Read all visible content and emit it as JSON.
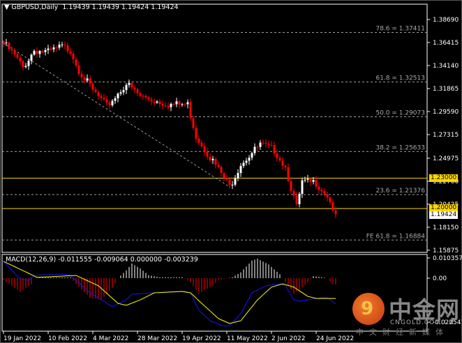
{
  "header": {
    "arrow": "▼",
    "symbol": "GBPUSD,Daily",
    "ohlc": "1.19439 1.19439 1.19424 1.19424"
  },
  "macd_header": "MACD(12,26,9) -0.011555 -0.009064 0.000000 -0.003239",
  "price_labels": {
    "line1": "1.23000",
    "line2": "1.20000",
    "current": "1.19424"
  },
  "colors": {
    "bull": "#ffffff",
    "bear": "#ff0000",
    "level": "#ffd700",
    "macd": "#1414ff",
    "signal": "#ffff00",
    "fib": "#a0a0a0"
  },
  "watermark": {
    "logo_char": "9",
    "name": "中金网",
    "url": "CNGOLD.COM.CN",
    "slogan": "中文财经新媒体"
  },
  "chart_data": {
    "type": "candlestick",
    "symbol": "GBPUSD",
    "timeframe": "Daily",
    "y_ticks": [
      "1.38690",
      "1.36415",
      "1.34140",
      "1.31865",
      "1.29590",
      "1.27315",
      "1.24975",
      "1.22700",
      "1.20425",
      "1.18150",
      "1.15875"
    ],
    "y_tick_values": [
      1.3869,
      1.36415,
      1.3414,
      1.31865,
      1.2959,
      1.27315,
      1.24975,
      1.227,
      1.20425,
      1.1815,
      1.15875
    ],
    "ylim": [
      1.155,
      1.392
    ],
    "x_ticks": [
      {
        "bar": 0,
        "label": "19 Jan 2022"
      },
      {
        "bar": 16,
        "label": "10 Feb 2022"
      },
      {
        "bar": 32,
        "label": "4 Mar 2022"
      },
      {
        "bar": 48,
        "label": "28 Mar 2022"
      },
      {
        "bar": 64,
        "label": "19 Apr 2022"
      },
      {
        "bar": 80,
        "label": "11 May 2022"
      },
      {
        "bar": 96,
        "label": "2 Jun 2022"
      },
      {
        "bar": 112,
        "label": "24 Jun 2022"
      }
    ],
    "bars": 120,
    "close_keypoints": [
      [
        0,
        1.3635
      ],
      [
        4,
        1.3511
      ],
      [
        7,
        1.3393
      ],
      [
        11,
        1.3566
      ],
      [
        16,
        1.3545
      ],
      [
        21,
        1.36
      ],
      [
        24,
        1.3566
      ],
      [
        27,
        1.337
      ],
      [
        32,
        1.3166
      ],
      [
        37,
        1.301
      ],
      [
        44,
        1.3235
      ],
      [
        49,
        1.311
      ],
      [
        54,
        1.307
      ],
      [
        60,
        1.3028
      ],
      [
        66,
        1.3028
      ],
      [
        69,
        1.2718
      ],
      [
        74,
        1.251
      ],
      [
        79,
        1.23
      ],
      [
        81,
        1.2214
      ],
      [
        85,
        1.2446
      ],
      [
        92,
        1.263
      ],
      [
        97,
        1.258
      ],
      [
        101,
        1.241
      ],
      [
        105,
        1.2007
      ],
      [
        107,
        1.2256
      ],
      [
        112,
        1.2256
      ],
      [
        116,
        1.213
      ],
      [
        119,
        1.19424
      ]
    ],
    "fib_levels": [
      {
        "label": "78.6 = 1.37411",
        "value": 1.37411
      },
      {
        "label": "61.8 = 1.32513",
        "value": 1.32513
      },
      {
        "label": "50.0 = 1.29073",
        "value": 1.29073
      },
      {
        "label": "38.2 = 1.25633",
        "value": 1.25633
      },
      {
        "label": "23.6 = 1.21376",
        "value": 1.21376
      },
      {
        "label": "FE 61.8 = 1.16884",
        "value": 1.16884
      }
    ],
    "horizontal_lines": [
      1.23,
      1.2
    ],
    "trendline": [
      [
        0,
        1.3635
      ],
      [
        81,
        1.2214
      ]
    ],
    "macd": {
      "y_ticks": [
        "0.010357",
        "0.00",
        "-0.022547"
      ],
      "y_tick_values": [
        0.010357,
        0,
        -0.022547
      ],
      "main_keypoints": [
        [
          0,
          0.0086
        ],
        [
          6,
          -0.0004
        ],
        [
          9,
          -0.0011
        ],
        [
          11,
          0.0014
        ],
        [
          21,
          0.0021
        ],
        [
          24,
          0.0014
        ],
        [
          31,
          -0.0075
        ],
        [
          39,
          -0.0146
        ],
        [
          44,
          -0.0111
        ],
        [
          46,
          -0.0082
        ],
        [
          59,
          -0.0071
        ],
        [
          65,
          -0.0068
        ],
        [
          67,
          -0.0075
        ],
        [
          70,
          -0.0164
        ],
        [
          74,
          -0.0218
        ],
        [
          79,
          -0.0246
        ],
        [
          81,
          -0.0243
        ],
        [
          85,
          -0.0182
        ],
        [
          89,
          -0.0075
        ],
        [
          94,
          -0.0039
        ],
        [
          99,
          -0.0029
        ],
        [
          101,
          -0.0039
        ],
        [
          104,
          -0.0111
        ],
        [
          106,
          -0.0118
        ],
        [
          114,
          -0.01
        ],
        [
          116,
          -0.01
        ],
        [
          119,
          -0.0132
        ]
      ],
      "signal_keypoints": [
        [
          0,
          0.0086
        ],
        [
          9,
          0.0025
        ],
        [
          12,
          0.0004
        ],
        [
          26,
          0.0014
        ],
        [
          34,
          -0.0039
        ],
        [
          41,
          -0.0129
        ],
        [
          44,
          -0.0139
        ],
        [
          49,
          -0.0111
        ],
        [
          54,
          -0.0075
        ],
        [
          64,
          -0.0068
        ],
        [
          67,
          -0.0075
        ],
        [
          71,
          -0.0129
        ],
        [
          77,
          -0.0207
        ],
        [
          81,
          -0.0232
        ],
        [
          85,
          -0.0218
        ],
        [
          91,
          -0.0111
        ],
        [
          96,
          -0.0046
        ],
        [
          100,
          -0.0029
        ],
        [
          104,
          -0.0046
        ],
        [
          109,
          -0.0093
        ],
        [
          112,
          -0.0104
        ],
        [
          119,
          -0.0104
        ]
      ],
      "hist_keypoints": [
        [
          0,
          -0.001
        ],
        [
          3,
          -0.004
        ],
        [
          6,
          -0.007
        ],
        [
          10,
          -0.003
        ],
        [
          11,
          0.0
        ],
        [
          14,
          0.0004
        ],
        [
          24,
          0.0004
        ],
        [
          26,
          -0.003
        ],
        [
          31,
          -0.01
        ],
        [
          35,
          -0.011
        ],
        [
          39,
          -0.005
        ],
        [
          41,
          0.0
        ],
        [
          44,
          0.004
        ],
        [
          46,
          0.0075
        ],
        [
          49,
          0.005
        ],
        [
          52,
          0.0015
        ],
        [
          56,
          0.0005
        ],
        [
          64,
          0.0005
        ],
        [
          67,
          -0.002
        ],
        [
          70,
          -0.008
        ],
        [
          72,
          -0.006
        ],
        [
          75,
          -0.004
        ],
        [
          77,
          -0.001
        ],
        [
          82,
          0.0005
        ],
        [
          85,
          0.003
        ],
        [
          89,
          0.009
        ],
        [
          91,
          0.01
        ],
        [
          95,
          0.007
        ],
        [
          99,
          0.002
        ],
        [
          101,
          -0.002
        ],
        [
          104,
          -0.008
        ],
        [
          106,
          -0.006
        ],
        [
          109,
          -0.002
        ],
        [
          111,
          0.001
        ],
        [
          114,
          0.0005
        ],
        [
          116,
          0.0
        ],
        [
          118,
          -0.003
        ],
        [
          119,
          -0.0032
        ]
      ]
    }
  }
}
